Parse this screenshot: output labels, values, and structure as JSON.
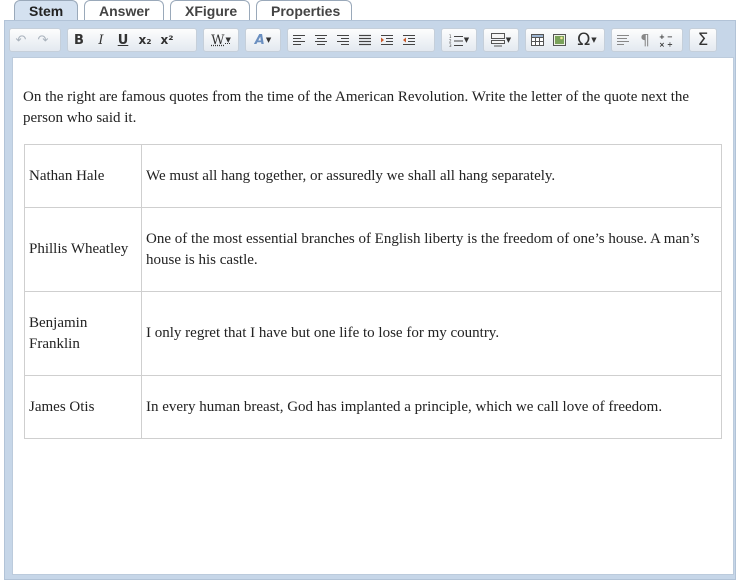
{
  "tabs": [
    {
      "label": "Stem",
      "active": true
    },
    {
      "label": "Answer",
      "active": false
    },
    {
      "label": "XFigure",
      "active": false
    },
    {
      "label": "Properties",
      "active": false
    }
  ],
  "toolbar": {
    "undo": "↶",
    "redo": "↷",
    "bold": "B",
    "italic": "I",
    "underline": "U",
    "subscript": "x₂",
    "superscript": "x²",
    "spellcheck": "W",
    "font_style": "A",
    "omega": "Ω",
    "pilcrow": "¶",
    "sigma": "Σ"
  },
  "content": {
    "intro": "On the right are famous quotes from the time of the American Revolution. Write the letter of the quote next the person who said it.",
    "rows": [
      {
        "person": "Nathan Hale",
        "quote": "We must all hang together, or assuredly we shall all hang separately."
      },
      {
        "person": "Phillis Wheatley",
        "quote": "One of the most essential branches of English liberty is the freedom of one’s house. A man’s house is his castle."
      },
      {
        "person": "Benjamin Franklin",
        "quote": "I only regret that I have but one life to lose for my country."
      },
      {
        "person": "James Otis",
        "quote": "In every human breast, God has implanted a principle, which we call love of freedom."
      }
    ]
  },
  "colors": {
    "frame": "#c6d6e8",
    "active_tab": "#d4e1f0"
  }
}
